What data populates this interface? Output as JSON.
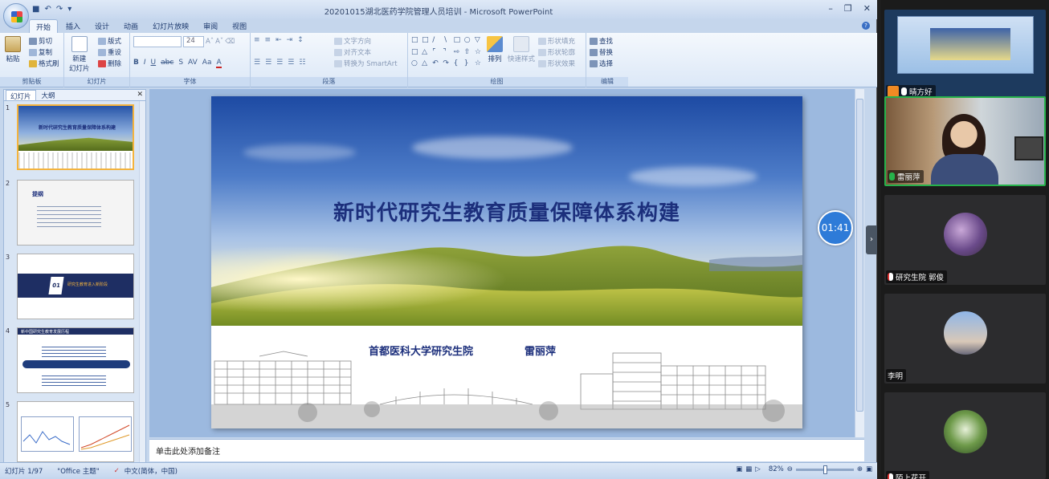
{
  "window": {
    "title": "20201015湖北医药学院管理人员培训 - Microsoft PowerPoint"
  },
  "ribbon_tabs": [
    "开始",
    "插入",
    "设计",
    "动画",
    "幻灯片放映",
    "审阅",
    "视图"
  ],
  "ribbon": {
    "clipboard": {
      "paste": "粘贴",
      "cut": "剪切",
      "copy": "复制",
      "format_painter": "格式刷",
      "label": "剪贴板"
    },
    "slides": {
      "new_slide": "新建",
      "new_slide2": "幻灯片",
      "layout": "版式",
      "reset": "重设",
      "delete": "删除",
      "label": "幻灯片"
    },
    "font": {
      "size": "24",
      "label": "字体"
    },
    "paragraph": {
      "text_direction": "文字方向",
      "align_text": "对齐文本",
      "smartart": "转换为 SmartArt",
      "label": "段落"
    },
    "drawing": {
      "arrange": "排列",
      "quick_styles": "快速样式",
      "fill": "形状填充",
      "outline": "形状轮廓",
      "effects": "形状效果",
      "label": "绘图"
    },
    "editing": {
      "find": "查找",
      "replace": "替换",
      "select": "选择",
      "label": "编辑"
    }
  },
  "panel": {
    "tabs": [
      "幻灯片",
      "大纲"
    ],
    "thumbs": [
      {
        "num": "1",
        "title": "新时代研究生教育质量保障体系构建"
      },
      {
        "num": "2",
        "title": "提纲"
      },
      {
        "num": "3",
        "title": "研究生教育进入新阶段",
        "badge": "01"
      },
      {
        "num": "4",
        "title": "新中国研究生教育发展历程"
      },
      {
        "num": "5",
        "title": ""
      }
    ]
  },
  "slide": {
    "title": "新时代研究生教育质量保障体系构建",
    "institution": "首都医科大学研究生院",
    "author": "雷丽萍"
  },
  "timer": "01:41",
  "notes_placeholder": "单击此处添加备注",
  "status": {
    "slide_count": "幻灯片 1/97",
    "theme": "\"Office 主题\"",
    "language": "中文(简体，中国)",
    "zoom": "82%"
  },
  "participants": [
    {
      "name": "晴方好",
      "muted": false
    },
    {
      "name": "雷丽萍",
      "muted": false
    },
    {
      "name": "研究生院 郭俊",
      "muted": true
    },
    {
      "name": "李明",
      "muted": false
    },
    {
      "name": "陌上花开",
      "muted": true
    }
  ],
  "colors": {
    "accent": "#2e7bd8",
    "title_blue": "#1c2f7c",
    "active_speaker": "#26b24b"
  }
}
